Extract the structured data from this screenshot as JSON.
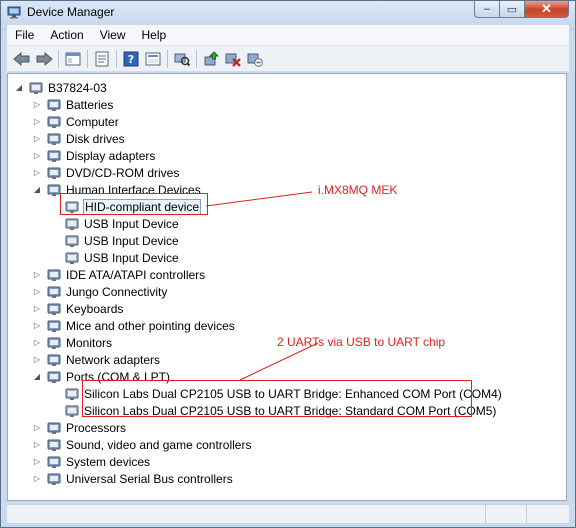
{
  "window": {
    "title": "Device Manager",
    "close_glyph": "✕",
    "max_glyph": "▭",
    "min_glyph": "‒"
  },
  "menu": [
    "File",
    "Action",
    "View",
    "Help"
  ],
  "toolbar_icons": [
    "back-arrow-icon",
    "forward-arrow-icon",
    "properties-icon",
    "view-icon",
    "help-icon",
    "console-tree-icon",
    "scan-hardware-icon",
    "update-driver-icon",
    "uninstall-icon",
    "disable-icon"
  ],
  "tree": {
    "root": "B37824-03",
    "categories": [
      {
        "label": "Batteries",
        "icon": "battery-icon"
      },
      {
        "label": "Computer",
        "icon": "computer-icon"
      },
      {
        "label": "Disk drives",
        "icon": "disk-drive-icon"
      },
      {
        "label": "Display adapters",
        "icon": "display-adapter-icon"
      },
      {
        "label": "DVD/CD-ROM drives",
        "icon": "dvd-drive-icon"
      },
      {
        "label": "Human Interface Devices",
        "icon": "hid-icon",
        "expanded": true,
        "children": [
          "HID-compliant device",
          "USB Input Device",
          "USB Input Device",
          "USB Input Device"
        ]
      },
      {
        "label": "IDE ATA/ATAPI controllers",
        "icon": "ide-controller-icon"
      },
      {
        "label": "Jungo Connectivity",
        "icon": "jungo-icon"
      },
      {
        "label": "Keyboards",
        "icon": "keyboard-icon"
      },
      {
        "label": "Mice and other pointing devices",
        "icon": "mouse-icon"
      },
      {
        "label": "Monitors",
        "icon": "monitor-icon"
      },
      {
        "label": "Network adapters",
        "icon": "network-adapter-icon"
      },
      {
        "label": "Ports (COM & LPT)",
        "icon": "port-icon",
        "expanded": true,
        "children": [
          "Silicon Labs Dual CP2105 USB to UART Bridge: Enhanced COM Port (COM4)",
          "Silicon Labs Dual CP2105 USB to UART Bridge: Standard COM Port (COM5)"
        ]
      },
      {
        "label": "Processors",
        "icon": "processor-icon"
      },
      {
        "label": "Sound, video and game controllers",
        "icon": "sound-icon"
      },
      {
        "label": "System devices",
        "icon": "system-devices-icon"
      },
      {
        "label": "Universal Serial Bus controllers",
        "icon": "usb-controller-icon"
      }
    ]
  },
  "annotations": {
    "mek": "i.MX8MQ MEK",
    "uarts": "2 UARTs via USB to UART chip",
    "color": "#e02020"
  },
  "colors": {
    "accent": "#e02020",
    "selection_border": "#7da2ce"
  }
}
